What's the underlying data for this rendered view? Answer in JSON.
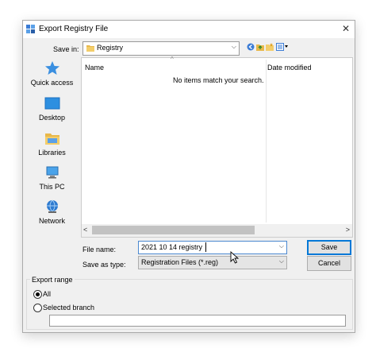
{
  "dialog": {
    "title": "Export Registry File",
    "close_glyph": "✕"
  },
  "savein": {
    "label": "Save in:",
    "value": "Registry",
    "arrow": "⌵"
  },
  "places": [
    {
      "label": "Quick access"
    },
    {
      "label": "Desktop"
    },
    {
      "label": "Libraries"
    },
    {
      "label": "This PC"
    },
    {
      "label": "Network"
    }
  ],
  "filelist": {
    "col_name": "Name",
    "col_date": "Date modified",
    "sort_glyph": "^",
    "empty_message": "No items match your search.",
    "scroll_left": "<",
    "scroll_right": ">"
  },
  "filename": {
    "label": "File name:",
    "value": "2021 10 14 registry",
    "arrow": "⌵"
  },
  "filetype": {
    "label": "Save as type:",
    "value": "Registration Files (*.reg)",
    "arrow": "⌵"
  },
  "buttons": {
    "save": "Save",
    "cancel": "Cancel"
  },
  "export_range": {
    "legend": "Export range",
    "all_label": "All",
    "branch_label": "Selected branch",
    "selected": "All",
    "branch_value": ""
  },
  "colors": {
    "accent": "#0078d7",
    "window_bg": "#f0f0f0"
  }
}
